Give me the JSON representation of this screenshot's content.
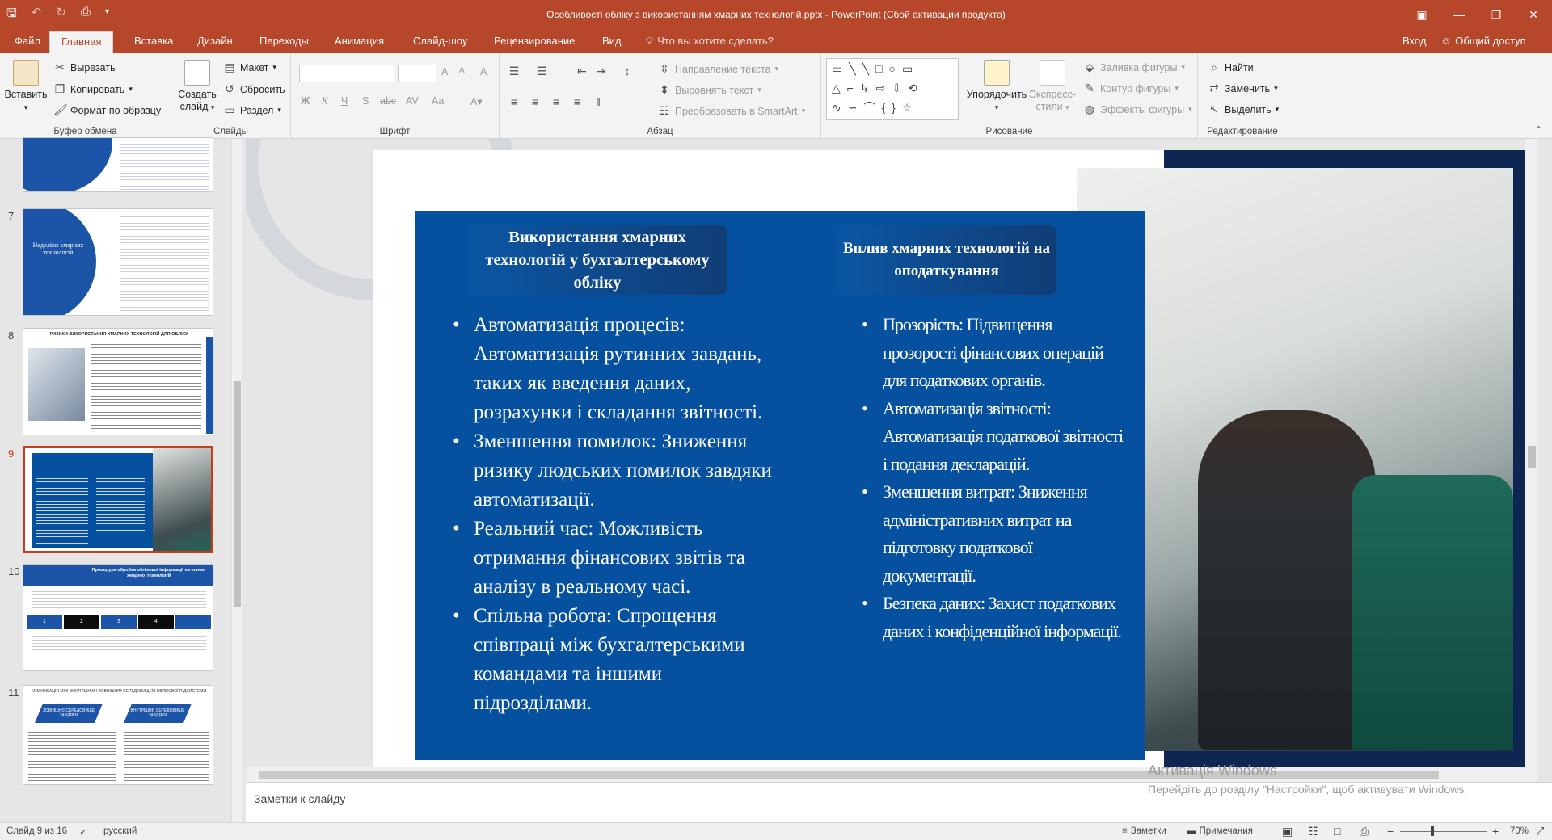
{
  "window": {
    "title": "Особливості обліку з використанням хмарних технологій.pptx - PowerPoint (Сбой активации продукта)"
  },
  "tabs": [
    "Файл",
    "Главная",
    "Вставка",
    "Дизайн",
    "Переходы",
    "Анимация",
    "Слайд-шоу",
    "Рецензирование",
    "Вид"
  ],
  "tell_me": "Что вы хотите сделать?",
  "signin": "Вход",
  "share": "Общий доступ",
  "ribbon": {
    "clipboard": {
      "paste": "Вставить",
      "cut": "Вырезать",
      "copy": "Копировать",
      "format_painter": "Формат по образцу",
      "label": "Буфер обмена"
    },
    "slides": {
      "new_slide_1": "Создать",
      "new_slide_2": "слайд",
      "layout": "Макет",
      "reset": "Сбросить",
      "section": "Раздел",
      "label": "Слайды"
    },
    "font": {
      "label": "Шрифт",
      "bold": "Ж",
      "italic": "К",
      "underline": "Ч",
      "strike": "S",
      "shadow": "abc",
      "spacing": "AV",
      "case": "Aa",
      "grow": "A",
      "shrink": "A",
      "clear": "A"
    },
    "paragraph": {
      "label": "Абзац",
      "text_dir": "Направление текста",
      "align_text": "Выровнять текст",
      "smartart": "Преобразовать в SmartArt"
    },
    "drawing": {
      "label": "Рисование",
      "arrange": "Упорядочить",
      "quick_styles_1": "Экспресс-",
      "quick_styles_2": "стили",
      "fill": "Заливка фигуры",
      "outline": "Контур фигуры",
      "effects": "Эффекты фигуры"
    },
    "editing": {
      "label": "Редактирование",
      "find": "Найти",
      "replace": "Заменить",
      "select": "Выделить"
    }
  },
  "thumbs": [
    {
      "num": "7",
      "title": "Недоліки хмарних технологій"
    },
    {
      "num": "8",
      "title": "РИЗИКИ ВИКОРИСТАННЯ ХМАРНИХ ТЕХНОЛОГІЙ ДЛЯ ОБЛІКУ"
    },
    {
      "num": "9"
    },
    {
      "num": "10",
      "title": "Процедура обробки облікової інформації на основі хмарних технологій",
      "steps": [
        "1",
        "2",
        "3",
        "4"
      ]
    },
    {
      "num": "11",
      "title": "КОМУНІКАЦІЯ МІЖ ВНУТРІШНІМ І ЗОВНІШНІМ СЕРЕДОВИЩЕМ ОБЛІКОВОЇ ПІДСИСТЕМИ",
      "box1": "ЗОВНІШНЄ СЕРЕДОВИЩЕ ЗАВДЯКИ",
      "box2": "ВНУТРІШНЄ СЕРЕДОВИЩЕ ЗАВДЯКИ"
    }
  ],
  "slide": {
    "left_heading": "Використання хмарних технологій у бухгалтерському обліку",
    "right_heading": "Вплив хмарних технологій на оподаткування",
    "left_bullets": [
      "Автоматизація процесів: Автоматизація рутинних завдань, таких як введення даних, розрахунки і складання звітності.",
      "Зменшення помилок: Зниження ризику людських помилок завдяки автоматизації.",
      "Реальний час: Можливість отримання фінансових звітів та аналізу в реальному часі.",
      "Спільна робота: Спрощення співпраці між бухгалтерськими командами та іншими підрозділами."
    ],
    "right_bullets": [
      "Прозорість: Підвищення прозорості фінансових операцій для податкових органів.",
      "Автоматизація звітності: Автоматизація податкової звітності і подання декларацій.",
      "Зменшення витрат: Зниження адміністративних витрат на підготовку податкової документації.",
      "Безпека даних: Захист податкових даних і конфіденційної інформації."
    ]
  },
  "notes_placeholder": "Заметки к слайду",
  "watermark": {
    "line1": "Активація Windows",
    "line2": "Перейдіть до розділу \"Настройки\", щоб активувати Windows."
  },
  "status": {
    "slide": "Слайд 9 из 16",
    "lang": "русский",
    "notes": "Заметки",
    "comments": "Примечания",
    "zoom": "70%"
  },
  "colors": {
    "accent": "#b7472a",
    "panel": "#05509f",
    "dark_navy": "#0e2752"
  }
}
